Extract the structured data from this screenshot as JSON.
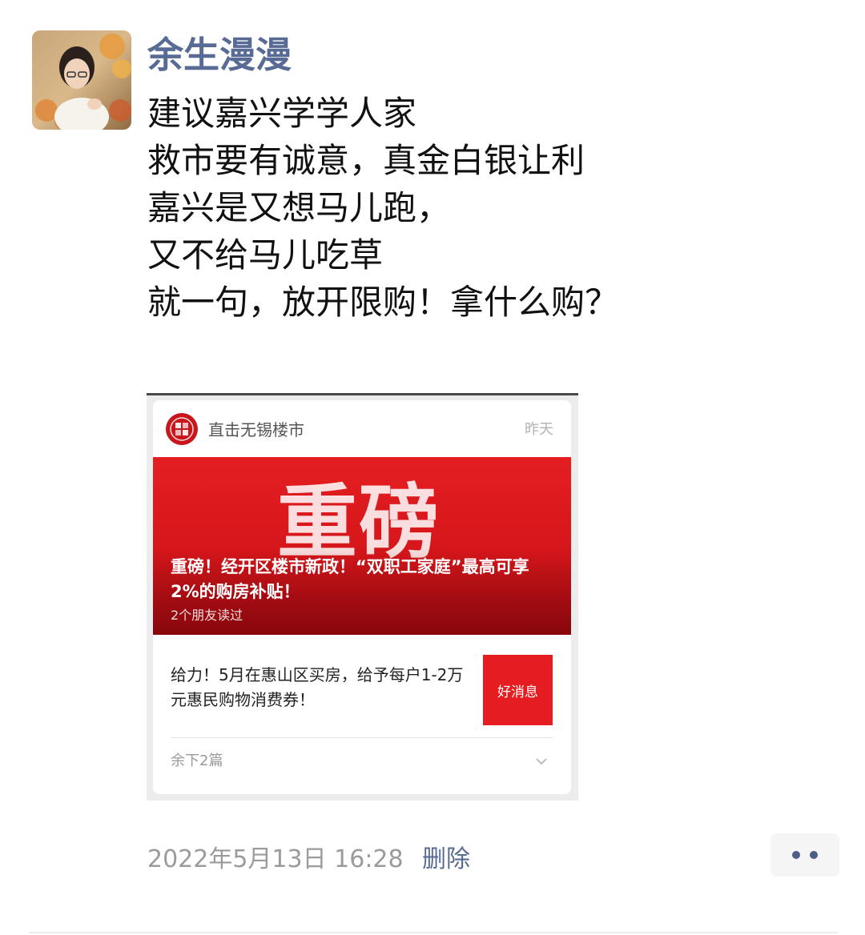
{
  "post": {
    "author": "余生漫漫",
    "lines": [
      "建议嘉兴学学人家",
      "救市要有诚意，真金白银让利",
      "嘉兴是又想马儿跑，",
      "又不给马儿吃草",
      "就一句，放开限购！拿什么购？"
    ],
    "timestamp": "2022年5月13日 16:28",
    "delete_label": "删除"
  },
  "shared_card": {
    "source_name": "直击无锡楼市",
    "source_time": "昨天",
    "banner_big_text": "重磅",
    "banner_title": "重磅！经开区楼市新政！“双职工家庭”最高可享2%的购房补贴！",
    "banner_read_count": "2个朋友读过",
    "sub_article_title": "给力！5月在惠山区买房，给予每户1-2万元惠民购物消费券！",
    "sub_article_thumb": "好消息",
    "more_label": "余下2篇"
  },
  "icons": {
    "avatar": "avatar",
    "source_logo": "source-logo-icon",
    "chevron": "chevron-down-icon",
    "more": "more-dots-icon"
  },
  "colors": {
    "link": "#576b95",
    "banner_red": "#e41e20",
    "timestamp_gray": "#9b9b9b"
  }
}
